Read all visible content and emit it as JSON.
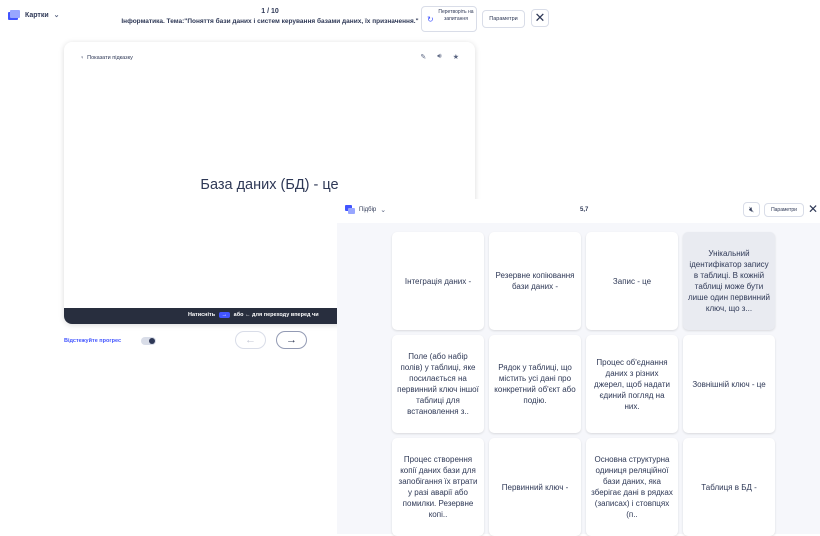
{
  "topbar": {
    "mode_label": "Картки",
    "counter": "1 / 10",
    "set_title": "Інформатика. Тема:\"Поняття бази даних і систем керування базами даних, їх призначення.\"",
    "convert_label": "Перетворіть на запитання",
    "params_label": "Параметри"
  },
  "card": {
    "hint_label": "Показати підказку",
    "term": "База даних (БД) - це",
    "footer_prefix": "Натисніть",
    "footer_key": "→",
    "footer_suffix": "або ← для переходу вперед чи"
  },
  "progress": {
    "track_label": "Відстежуйте прогрес"
  },
  "match": {
    "mode_label": "Підбір",
    "timer": "5,7",
    "params_label": "Параметри",
    "tiles": [
      {
        "text": "Інтеграція даних -",
        "selected": false
      },
      {
        "text": "Резервне копіювання бази даних -",
        "selected": false
      },
      {
        "text": "Запис - це",
        "selected": false
      },
      {
        "text": "Унікальний ідентифікатор запису в таблиці. В кожній таблиці може бути лише один первинний ключ, що з...",
        "selected": true
      },
      {
        "text": "Поле (або набір полів) у таблиці, яке посилається на первинний ключ іншої таблиці для встановлення з..",
        "selected": false
      },
      {
        "text": "Рядок у таблиці, що містить усі дані про конкретний об'єкт або подію.",
        "selected": false
      },
      {
        "text": "Процес об'єднання даних з різних джерел, щоб надати єдиний погляд на них.",
        "selected": false
      },
      {
        "text": "Зовнішній ключ - це",
        "selected": false
      },
      {
        "text": "Процес створення копії даних бази для запобігання їх втрати у разі аварії або помилки. Резервне копі..",
        "selected": false
      },
      {
        "text": "Первинний ключ -",
        "selected": false
      },
      {
        "text": "Основна структурна одиниця реляційної бази даних, яка зберігає дані в рядках (записах) і стовпцях (п..",
        "selected": false
      },
      {
        "text": "Таблиця в БД -",
        "selected": false
      }
    ]
  },
  "colors": {
    "accent": "#4255ff",
    "text": "#2e3856",
    "footer": "#282e3e"
  }
}
